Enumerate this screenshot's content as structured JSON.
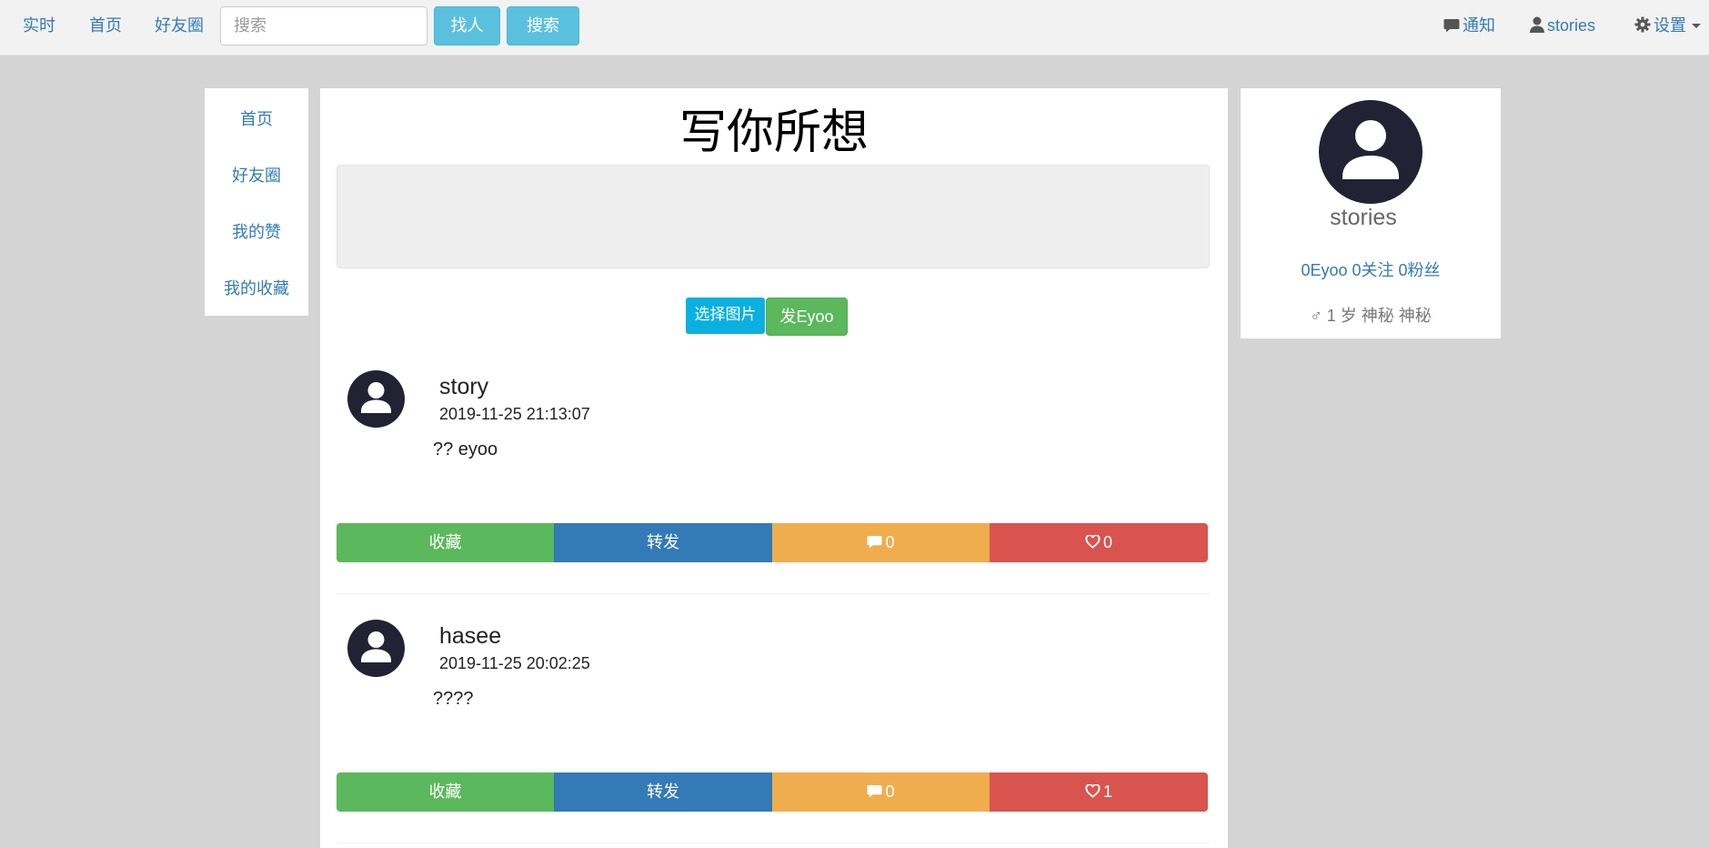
{
  "navbar": {
    "links": [
      "实时",
      "首页",
      "好友圈"
    ],
    "search_placeholder": "搜索",
    "find_people_label": "找人",
    "search_label": "搜索",
    "notifications_label": "通知",
    "user_label": "stories",
    "settings_label": "设置"
  },
  "sidebar": {
    "items": [
      "首页",
      "好友圈",
      "我的赞",
      "我的收藏"
    ]
  },
  "compose": {
    "title": "写你所想",
    "pick_image_label": "选择图片",
    "post_label": "发Eyoo"
  },
  "posts": [
    {
      "user": "story",
      "time": "2019-11-25 21:13:07",
      "text": "?? eyoo",
      "favorite_label": "收藏",
      "repost_label": "转发",
      "comments": "0",
      "likes": "0"
    },
    {
      "user": "hasee",
      "time": "2019-11-25 20:02:25",
      "text": "????",
      "favorite_label": "收藏",
      "repost_label": "转发",
      "comments": "0",
      "likes": "1"
    }
  ],
  "profile": {
    "name": "stories",
    "eyoo_count": "0Eyoo",
    "following": "0关注",
    "followers": "0粉丝",
    "gender_symbol": "♂",
    "info": "1 岁 神秘 神秘"
  },
  "colors": {
    "favorite": "#5cb85c",
    "repost": "#337ab7",
    "comment": "#f0ad4e",
    "like": "#d9534f",
    "avatar": "#232234"
  },
  "icons": [
    "comment-icon",
    "user-icon",
    "gear-icon",
    "heart-icon",
    "avatar-icon"
  ]
}
